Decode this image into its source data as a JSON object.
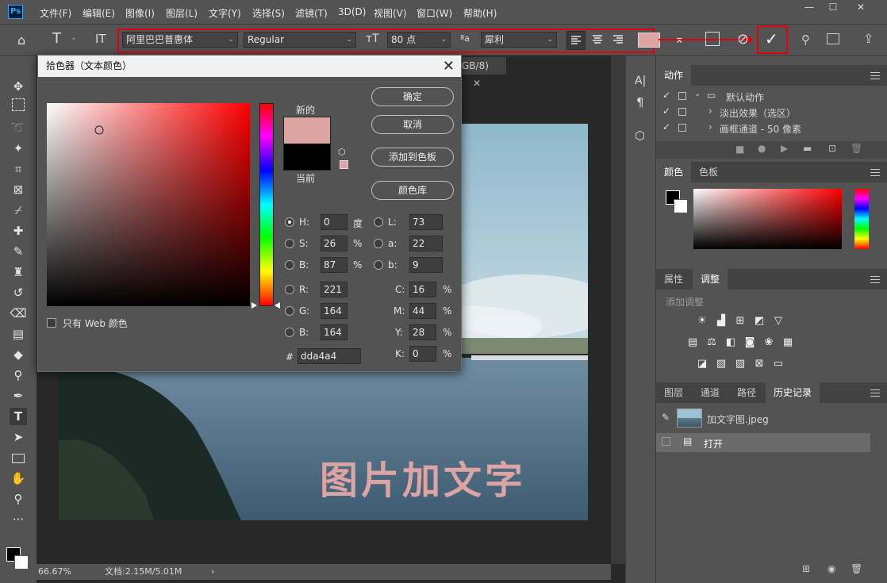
{
  "app": {
    "logo": "Ps",
    "menu": [
      "文件(F)",
      "编辑(E)",
      "图像(I)",
      "图层(L)",
      "文字(Y)",
      "选择(S)",
      "滤镜(T)",
      "3D(D)",
      "视图(V)",
      "窗口(W)",
      "帮助(H)"
    ]
  },
  "options": {
    "font_family": "阿里巴巴普惠体",
    "font_style": "Regular",
    "font_size": "80 点",
    "antialias_label": "ªa",
    "antialias": "犀利",
    "text_color": "#dda4a4"
  },
  "document": {
    "tab_label": "GB/8)",
    "overlay_text": "图片加文字",
    "zoom": "66.67%",
    "doc_info": "文档:2.15M/5.01M"
  },
  "color_picker": {
    "title": "拾色器（文本颜色）",
    "new_label": "新的",
    "current_label": "当前",
    "new_color": "#dda4a4",
    "current_color": "#000000",
    "buttons": {
      "ok": "确定",
      "cancel": "取消",
      "add_swatch": "添加到色板",
      "libraries": "颜色库"
    },
    "web_only": "只有 Web 颜色",
    "fields": {
      "H": {
        "label": "H:",
        "value": "0",
        "unit": "度"
      },
      "S": {
        "label": "S:",
        "value": "26",
        "unit": "%"
      },
      "B": {
        "label": "B:",
        "value": "87",
        "unit": "%"
      },
      "R": {
        "label": "R:",
        "value": "221"
      },
      "G": {
        "label": "G:",
        "value": "164"
      },
      "Bb": {
        "label": "B:",
        "value": "164"
      },
      "L": {
        "label": "L:",
        "value": "73"
      },
      "a": {
        "label": "a:",
        "value": "22"
      },
      "b": {
        "label": "b:",
        "value": "9"
      },
      "C": {
        "label": "C:",
        "value": "16",
        "unit": "%"
      },
      "M": {
        "label": "M:",
        "value": "44",
        "unit": "%"
      },
      "Y": {
        "label": "Y:",
        "value": "28",
        "unit": "%"
      },
      "K": {
        "label": "K:",
        "value": "0",
        "unit": "%"
      },
      "hex_label": "#",
      "hex": "dda4a4"
    }
  },
  "panels": {
    "actions": {
      "tab": "动作",
      "items": [
        "默认动作",
        "淡出效果（选区）",
        "画框通道 - 50 像素"
      ]
    },
    "color": {
      "tabs": [
        "颜色",
        "色板"
      ]
    },
    "adjust": {
      "tabs": [
        "属性",
        "调整"
      ],
      "add_label": "添加调整"
    },
    "layers": {
      "tabs": [
        "图层",
        "通道",
        "路径",
        "历史记录"
      ],
      "history": [
        "加文字图.jpeg",
        "打开"
      ]
    }
  }
}
